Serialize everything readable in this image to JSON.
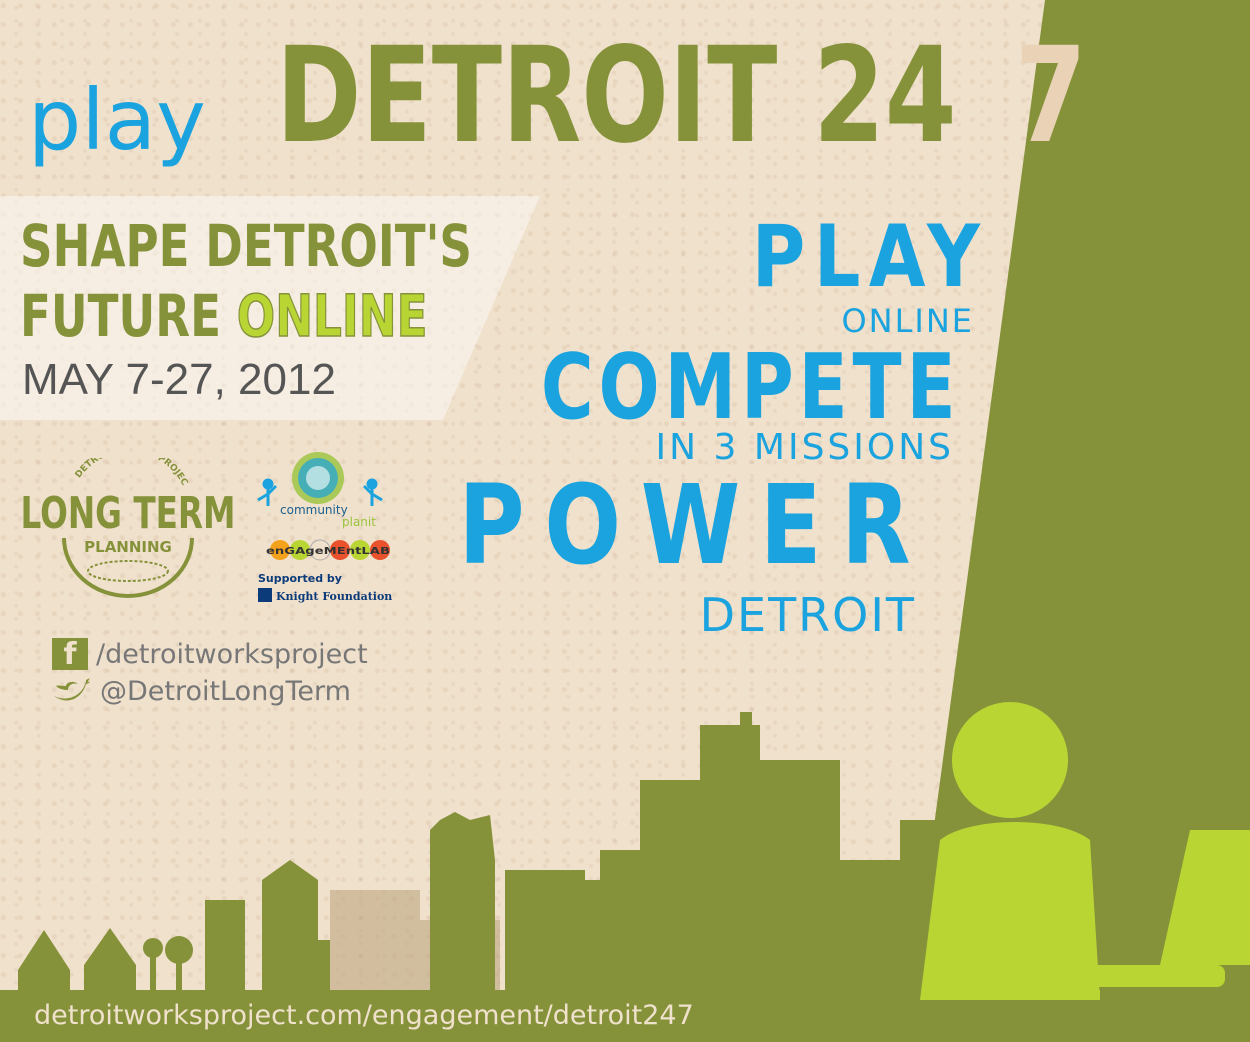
{
  "header": {
    "play_word": "play",
    "title_main": "DETROIT 24",
    "title_last": "7"
  },
  "left": {
    "shape_line1": "SHAPE DETROIT'S",
    "shape_line2_a": "FUTURE ",
    "shape_line2_b": "ONLINE",
    "dates": "MAY 7-27, 2012"
  },
  "right": {
    "play": "PLAY",
    "online": "ONLINE",
    "compete": "COMPETE",
    "missions": "IN 3 MISSIONS",
    "power": "POWER",
    "detroit": "DETROIT"
  },
  "logos": {
    "ltp_arc_text": "DETROIT WORKS PROJECT",
    "ltp_main": "LONG TERM",
    "ltp_sub": "PLANNING",
    "community": "community",
    "planit": "planit",
    "engagement_lab": "enGAgeMEntLAB",
    "supported_by": "Supported by",
    "knight": "Knight Foundation"
  },
  "social": {
    "facebook_handle": "/detroitworksproject",
    "twitter_handle": "@DetroitLongTerm"
  },
  "footer": {
    "url": "detroitworksproject.com/engagement/detroit247"
  },
  "colors": {
    "olive": "#85923a",
    "lime": "#b9d534",
    "blue": "#1aa3de",
    "background": "#f0e1cc"
  }
}
